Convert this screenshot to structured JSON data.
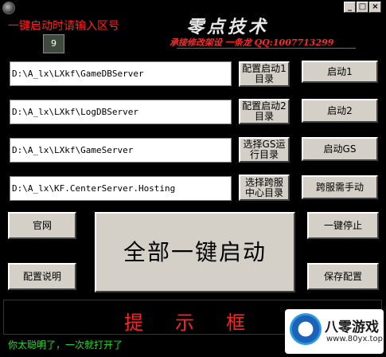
{
  "window": {
    "icon": "app-gear-icon",
    "controls": {
      "minimize": "_",
      "maximize": "□",
      "close": "×"
    }
  },
  "header": {
    "zone_prompt": "一键启动时请输入区号",
    "zone_value": "9",
    "brand_title": "零点技术",
    "brand_subtitle": "承接修改架设 一条龙 QQ:1007713299"
  },
  "rows": [
    {
      "path": "D:\\A_lx\\LXkf\\GameDBServer",
      "config_label": "配置启动1目录",
      "start_label": "启动1"
    },
    {
      "path": "D:\\A_lx\\LXkf\\LogDBServer",
      "config_label": "配置启动2目录",
      "start_label": "启动2"
    },
    {
      "path": "D:\\A_lx\\LXkf\\GameServer",
      "config_label": "选择GS运行目录",
      "start_label": "启动GS"
    },
    {
      "path": "D:\\A_lx\\KF.CenterServer.Hosting",
      "config_label": "选择跨服中心目录",
      "start_label": "跨服需手动"
    }
  ],
  "buttons": {
    "website": "官网",
    "config_help": "配置说明",
    "one_click_start": "全部一键启动",
    "one_click_stop": "一键停止",
    "save_config": "保存配置"
  },
  "prompt_box": {
    "label": "提示框"
  },
  "status": {
    "message": "你太聪明了，一次就打开了"
  },
  "watermark": {
    "name": "八零游戏",
    "url": "www.80yx.top",
    "logo": "site-logo-icon"
  },
  "colors": {
    "background": "#000000",
    "label_red": "#ff2020",
    "status_green": "#19e019",
    "button_face": "#d4d0c8"
  }
}
